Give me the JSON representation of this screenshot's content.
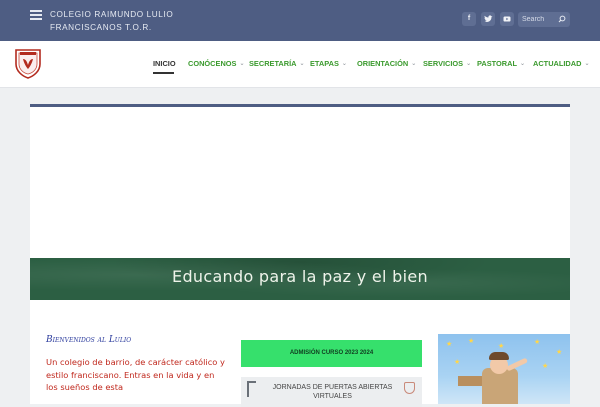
{
  "header": {
    "site_title": "COLEGIO RAIMUNDO LULIO FRANCISCANOS T.O.R.",
    "social_icons": [
      "facebook-icon",
      "twitter-icon",
      "youtube-icon"
    ],
    "search_placeholder": "Search"
  },
  "nav": {
    "items": [
      {
        "label": "INICIO",
        "active": true,
        "dropdown": false
      },
      {
        "label": "CONÓCENOS",
        "active": false,
        "dropdown": true
      },
      {
        "label": "SECRETARÍA",
        "active": false,
        "dropdown": true
      },
      {
        "label": "ETAPAS",
        "active": false,
        "dropdown": true
      },
      {
        "label": "ORIENTACIÓN",
        "active": false,
        "dropdown": true
      },
      {
        "label": "SERVICIOS",
        "active": false,
        "dropdown": true
      },
      {
        "label": "PASTORAL",
        "active": false,
        "dropdown": true
      },
      {
        "label": "ACTUALIDAD",
        "active": false,
        "dropdown": true
      }
    ]
  },
  "banner": {
    "text": "Educando para la paz y el bien"
  },
  "welcome": {
    "title": "Bienvenidos al Lulio",
    "text": "Un colegio de barrio, de carácter católico y estilo franciscano. Entras en la vida y en los sueños de esta"
  },
  "widgets": {
    "admission_label": "ADMISIÓN CURSO 2023 2024",
    "openday_label": "JORNADAS DE PUERTAS ABIERTAS VIRTUALES"
  },
  "colors": {
    "topbar": "#4e5d83",
    "nav_link": "#3b9a2e",
    "banner": "#2c5f43",
    "admission_button": "#36e06c",
    "welcome_title": "#2a3a9c",
    "welcome_text": "#c0281d"
  }
}
